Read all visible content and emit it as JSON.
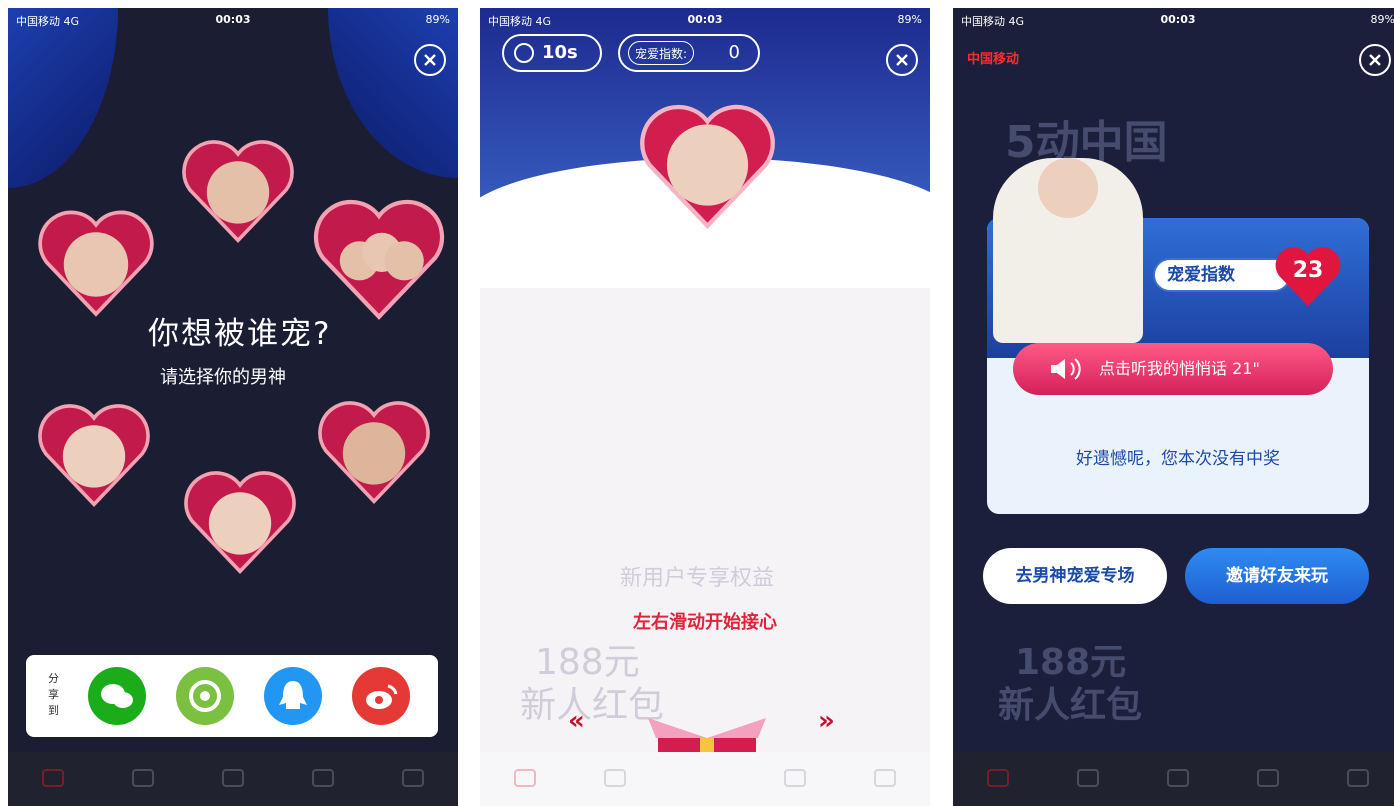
{
  "status_bar": {
    "carrier": "中国移动",
    "network": "4G",
    "time": "00:03",
    "battery": "89%"
  },
  "screen1": {
    "title": "你想被谁宠?",
    "subtitle": "请选择你的男神",
    "share": {
      "label": "分享到",
      "buttons": [
        "wechat-icon",
        "moments-icon",
        "qq-icon",
        "weibo-icon"
      ]
    },
    "colors": {
      "wechat": "#1aad19",
      "moments": "#7ac142",
      "qq": "#2196f3",
      "weibo": "#e53935"
    }
  },
  "screen2": {
    "timer": "10s",
    "score_label": "宠爱指数:",
    "score_value": "0",
    "hint": "左右滑动开始接心",
    "left_arrows": "«",
    "right_arrows": "»",
    "faded_section_title": "新用户专享权益",
    "faded_amount": "188元",
    "faded_label": "新人红包"
  },
  "screen3": {
    "logo": "中国移动",
    "pet_label": "宠爱指数",
    "pet_value": "23",
    "listen_button": "点击听我的悄悄话 21\"",
    "result": "好遗憾呢，您本次没有中奖",
    "button_left": "去男神宠爱专场",
    "button_right": "邀请好友来玩",
    "faded_banner": "5动中国",
    "faded_amount": "188元",
    "faded_label": "新人红包"
  }
}
